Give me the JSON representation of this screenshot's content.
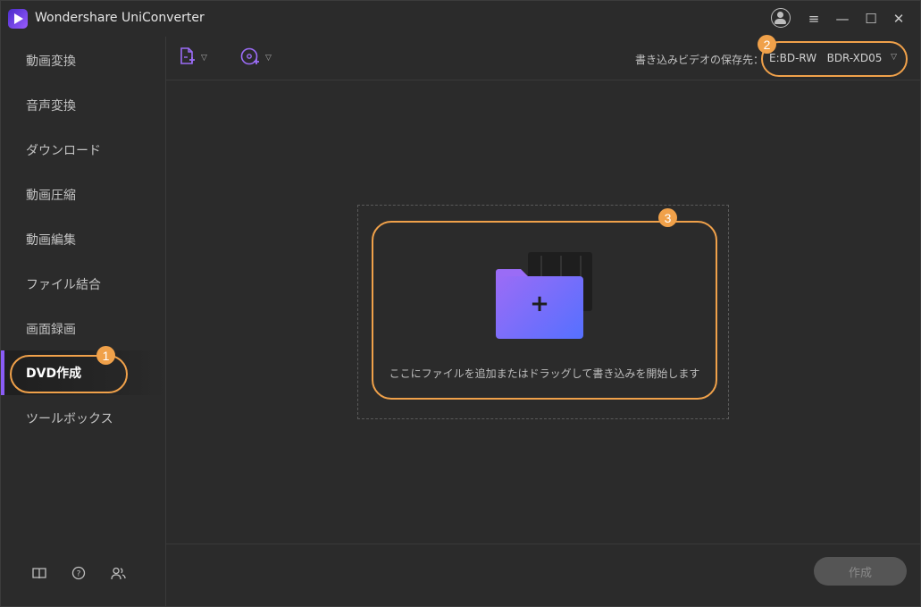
{
  "app": {
    "title": "Wondershare UniConverter"
  },
  "window_controls": {
    "account_icon": "user-circle-icon",
    "menu": "≡",
    "minimize": "—",
    "maximize": "☐",
    "close": "✕"
  },
  "sidebar": {
    "items": [
      {
        "label": "動画変換",
        "active": false
      },
      {
        "label": "音声変換",
        "active": false
      },
      {
        "label": "ダウンロード",
        "active": false
      },
      {
        "label": "動画圧縮",
        "active": false
      },
      {
        "label": "動画編集",
        "active": false
      },
      {
        "label": "ファイル結合",
        "active": false
      },
      {
        "label": "画面録画",
        "active": false
      },
      {
        "label": "DVD作成",
        "active": true
      },
      {
        "label": "ツールボックス",
        "active": false
      }
    ],
    "bottom_icons": [
      "book-icon",
      "help-icon",
      "users-icon"
    ]
  },
  "toolbar": {
    "add_file_icon": "add-file-icon",
    "add_disc_icon": "add-disc-icon",
    "save_destination_label": "書き込みビデオの保存先：",
    "drive_value": "E:BD-RW   BDR-XD05"
  },
  "drop_zone": {
    "hint": "ここにファイルを追加またはドラッグして書き込みを開始します"
  },
  "annotations": {
    "badge1": "1",
    "badge2": "2",
    "badge3": "3"
  },
  "footer": {
    "create_label": "作成"
  },
  "colors": {
    "accent": "#8a5cf6",
    "annotation": "#f0a14a",
    "background": "#2b2b2b"
  }
}
